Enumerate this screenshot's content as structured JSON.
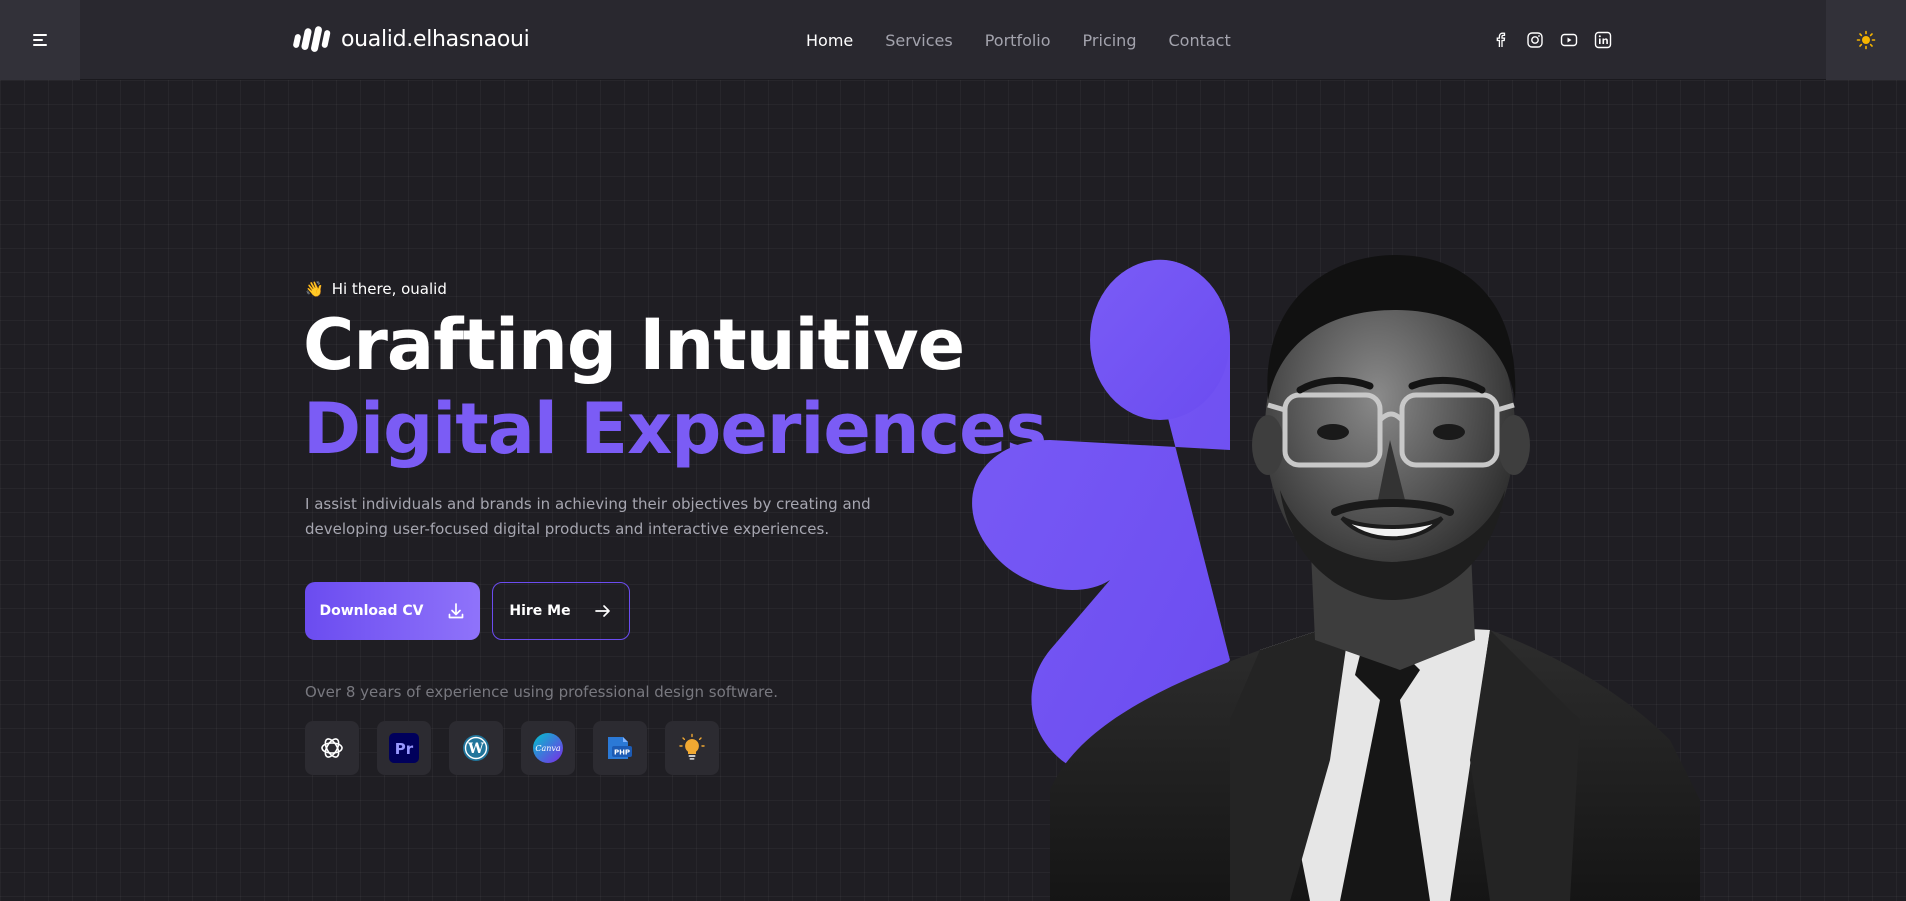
{
  "header": {
    "logo_text": "oualid.elhasnaoui",
    "nav": [
      {
        "label": "Home",
        "active": true
      },
      {
        "label": "Services",
        "active": false
      },
      {
        "label": "Portfolio",
        "active": false
      },
      {
        "label": "Pricing",
        "active": false
      },
      {
        "label": "Contact",
        "active": false
      }
    ],
    "socials": [
      "facebook-icon",
      "instagram-icon",
      "youtube-icon",
      "linkedin-icon"
    ],
    "menu_icon": "menu-icon",
    "theme_icon": "sun-icon"
  },
  "hero": {
    "greeting": "Hi there, oualid",
    "greeting_emoji": "👋",
    "title_line1": "Crafting Intuitive",
    "title_line2": "Digital Experiences",
    "description": "I assist individuals and brands in achieving their objectives by creating and developing user-focused digital products and interactive experiences.",
    "download_label": "Download CV",
    "hire_label": "Hire Me",
    "experience_text": "Over 8 years of experience using professional design software.",
    "tools": [
      "openai-icon",
      "premiere-pro-icon",
      "wordpress-icon",
      "canva-icon",
      "php-icon",
      "idea-bulb-icon"
    ]
  },
  "colors": {
    "accent": "#7b5cf5",
    "background": "#1f1e23",
    "header": "#29282f"
  }
}
